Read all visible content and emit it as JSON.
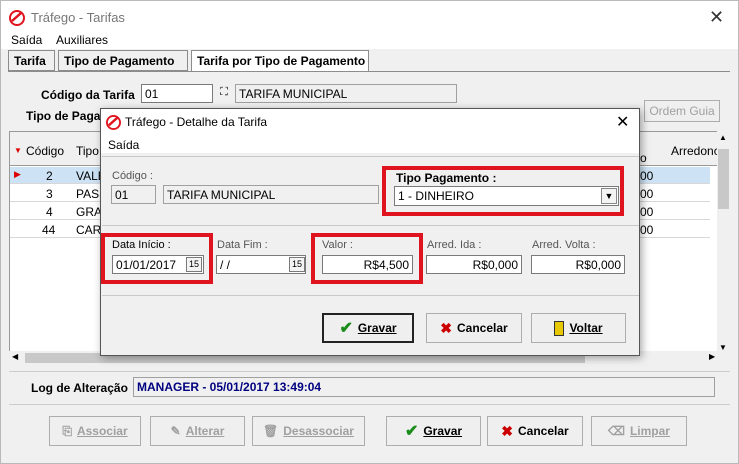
{
  "window": {
    "title": "Tráfego - Tarifas"
  },
  "menu": [
    "Saída",
    "Auxiliares"
  ],
  "tabs": [
    "Tarifa",
    "Tipo de Pagamento",
    "Tarifa por Tipo de Pagamento"
  ],
  "form": {
    "codigo_label": "Código da Tarifa",
    "codigo_value": "01",
    "tarifa_nome": "TARIFA MUNICIPAL",
    "tipo_label": "Tipo de Paga",
    "ordem_button": "Ordem Guia"
  },
  "grid": {
    "headers": {
      "codigo": "Código",
      "tipo": "Tipo",
      "arredondamento": "Arredonc"
    },
    "rows": [
      {
        "codigo": "2",
        "tipo": "VALE"
      },
      {
        "codigo": "3",
        "tipo": "PASS"
      },
      {
        "codigo": "4",
        "tipo": "GRA"
      },
      {
        "codigo": "44",
        "tipo": "CART"
      }
    ],
    "side_values": [
      "00",
      "00",
      "00",
      "00"
    ],
    "header_side": "o"
  },
  "log": {
    "label": "Log de Alteração",
    "value": "MANAGER - 05/01/2017 13:49:04"
  },
  "buttons": {
    "associar": "Associar",
    "alterar": "Alterar",
    "desassociar": "Desassociar",
    "gravar": "Gravar",
    "cancelar": "Cancelar",
    "limpar": "Limpar"
  },
  "dialog": {
    "title": "Tráfego - Detalhe da Tarifa",
    "menu": "Saída",
    "codigo_label": "Código :",
    "codigo_value": "01",
    "tarifa_nome": "TARIFA MUNICIPAL",
    "tipo_pagamento_label": "Tipo Pagamento :",
    "tipo_pagamento_value": "1 - DINHEIRO",
    "data_inicio_label": "Data Início :",
    "data_inicio_value": "01/01/2017",
    "data_fim_label": "Data Fim :",
    "data_fim_value": "/ /",
    "valor_label": "Valor :",
    "valor_value": "R$4,500",
    "arred_ida_label": "Arred. Ida :",
    "arred_ida_value": "R$0,000",
    "arred_volta_label": "Arred. Volta :",
    "arred_volta_value": "R$0,000",
    "cal_glyph": "15",
    "gravar": "Gravar",
    "cancelar": "Cancelar",
    "voltar": "Voltar"
  },
  "colors": {
    "highlight": "#e0141e",
    "selected_row": "#cde3f5",
    "log_text": "#000080"
  }
}
